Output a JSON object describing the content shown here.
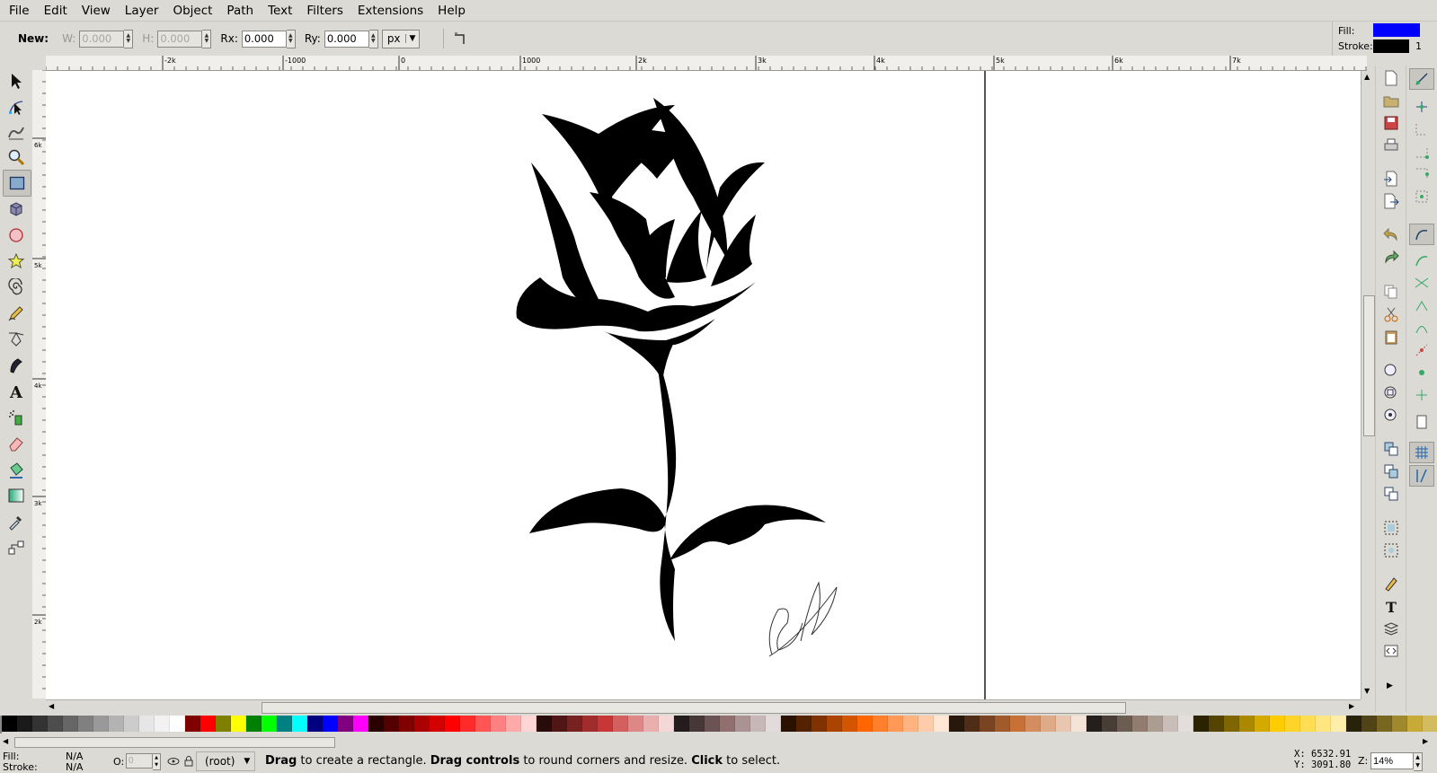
{
  "menu": [
    "File",
    "Edit",
    "View",
    "Layer",
    "Object",
    "Path",
    "Text",
    "Filters",
    "Extensions",
    "Help"
  ],
  "tool_controls": {
    "new_label": "New:",
    "w_label": "W:",
    "w_value": "0.000",
    "h_label": "H:",
    "h_value": "0.000",
    "rx_label": "Rx:",
    "rx_value": "0.000",
    "ry_label": "Ry:",
    "ry_value": "0.000",
    "unit": "px"
  },
  "style_indicator": {
    "fill_label": "Fill:",
    "fill_color": "#0000ff",
    "stroke_label": "Stroke:",
    "stroke_color": "#000000",
    "stroke_width": "1"
  },
  "tools": [
    "select-arrow-icon",
    "node-editor-icon",
    "tweak-icon",
    "zoom-icon",
    "rectangle-icon",
    "box-3d-icon",
    "ellipse-icon",
    "star-icon",
    "spiral-icon",
    "pencil-icon",
    "pen-icon",
    "calligraphy-icon",
    "text-tool-icon",
    "spray-icon",
    "eraser-icon",
    "paint-bucket-icon",
    "gradient-icon",
    "dropper-icon",
    "connector-icon"
  ],
  "active_tool": "rectangle-icon",
  "ruler": {
    "h_ticks": [
      "-2k",
      "-1000",
      "0",
      "1000",
      "2k",
      "3k",
      "4k",
      "5k",
      "6k",
      "7k"
    ],
    "v_ticks": [
      "6k",
      "5k",
      "4k",
      "3k",
      "2k"
    ]
  },
  "palette": [
    "#000000",
    "#1a1a1a",
    "#333333",
    "#4d4d4d",
    "#666666",
    "#808080",
    "#999999",
    "#b3b3b3",
    "#cccccc",
    "#e6e6e6",
    "#f2f2f2",
    "#ffffff",
    "#800000",
    "#ff0000",
    "#808000",
    "#ffff00",
    "#008000",
    "#00ff00",
    "#008080",
    "#00ffff",
    "#000080",
    "#0000ff",
    "#800080",
    "#ff00ff",
    "#2b0000",
    "#550000",
    "#800000",
    "#aa0000",
    "#d40000",
    "#ff0000",
    "#ff2a2a",
    "#ff5555",
    "#ff8080",
    "#ffaaaa",
    "#ffd5d5",
    "#280b0b",
    "#501616",
    "#782121",
    "#a02c2c",
    "#c83737",
    "#d35f5f",
    "#de8787",
    "#e9afaf",
    "#f4d7d7",
    "#241c1c",
    "#483737",
    "#6c5353",
    "#916f6f",
    "#ac9393",
    "#c8b7b7",
    "#e3dbdb",
    "#2b1100",
    "#552200",
    "#803300",
    "#aa4400",
    "#d45500",
    "#ff6600",
    "#ff7f2a",
    "#ff9955",
    "#ffb380",
    "#ffccaa",
    "#ffe6d5",
    "#28170b",
    "#502d16",
    "#784421",
    "#a05a2c",
    "#c87137",
    "#d38d5f",
    "#deaa87",
    "#e9c6af",
    "#f4e3d7",
    "#241f1c",
    "#483e37",
    "#6c5d53",
    "#917c6f",
    "#ac9d93",
    "#c8beb7",
    "#e3dedb",
    "#2b2200",
    "#554400",
    "#806600",
    "#aa8800",
    "#d4aa00",
    "#ffcc00",
    "#ffd42a",
    "#ffdd55",
    "#ffe680",
    "#ffeeaa",
    "#28220b",
    "#504416",
    "#786721",
    "#a0892c",
    "#c8ab37",
    "#d3bc5f"
  ],
  "status": {
    "fill_label": "Fill:",
    "fill_value": "N/A",
    "stroke_label": "Stroke:",
    "stroke_value": "N/A",
    "opacity_label": "O:",
    "opacity_value": "0",
    "layer": "(root)",
    "msg_1b": "Drag",
    "msg_1": " to create a rectangle. ",
    "msg_2b": "Drag controls",
    "msg_2": " to round corners and resize. ",
    "msg_3b": "Click",
    "msg_3": " to select.",
    "x_coord": "X: 6532.91",
    "y_coord": "Y: 3091.80",
    "zoom_label": "Z:",
    "zoom_value": "14%"
  }
}
